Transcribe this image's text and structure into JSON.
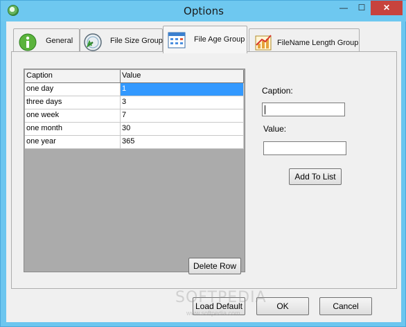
{
  "window": {
    "title": "Options"
  },
  "titlebar_buttons": {
    "minimize": "—",
    "maximize": "☐",
    "close": "✕"
  },
  "tabs": [
    {
      "label": "General",
      "icon": "info-icon"
    },
    {
      "label": "File Size Group",
      "icon": "gauge-icon"
    },
    {
      "label": "File Age Group",
      "icon": "calendar-icon"
    },
    {
      "label": "FileName Length Group",
      "icon": "bar-chart-icon"
    }
  ],
  "grid": {
    "headers": [
      "Caption",
      "Value"
    ],
    "rows": [
      {
        "caption": "one day",
        "value": "1"
      },
      {
        "caption": "three days",
        "value": "3"
      },
      {
        "caption": "one week",
        "value": "7"
      },
      {
        "caption": "one month",
        "value": "30"
      },
      {
        "caption": "one year",
        "value": "365"
      }
    ]
  },
  "form": {
    "caption_label": "Caption:",
    "caption_value": "",
    "value_label": "Value:",
    "value_value": "",
    "add_button": "Add To List"
  },
  "delete_button": "Delete Row",
  "footer": {
    "load_default": "Load Default",
    "ok": "OK",
    "cancel": "Cancel"
  },
  "watermark": {
    "brand": "SOFTPEDIA",
    "url": "www.softpedia.com"
  },
  "colors": {
    "selection": "#3399ff",
    "titlebar": "#6ec8f0",
    "close": "#c7433d"
  }
}
